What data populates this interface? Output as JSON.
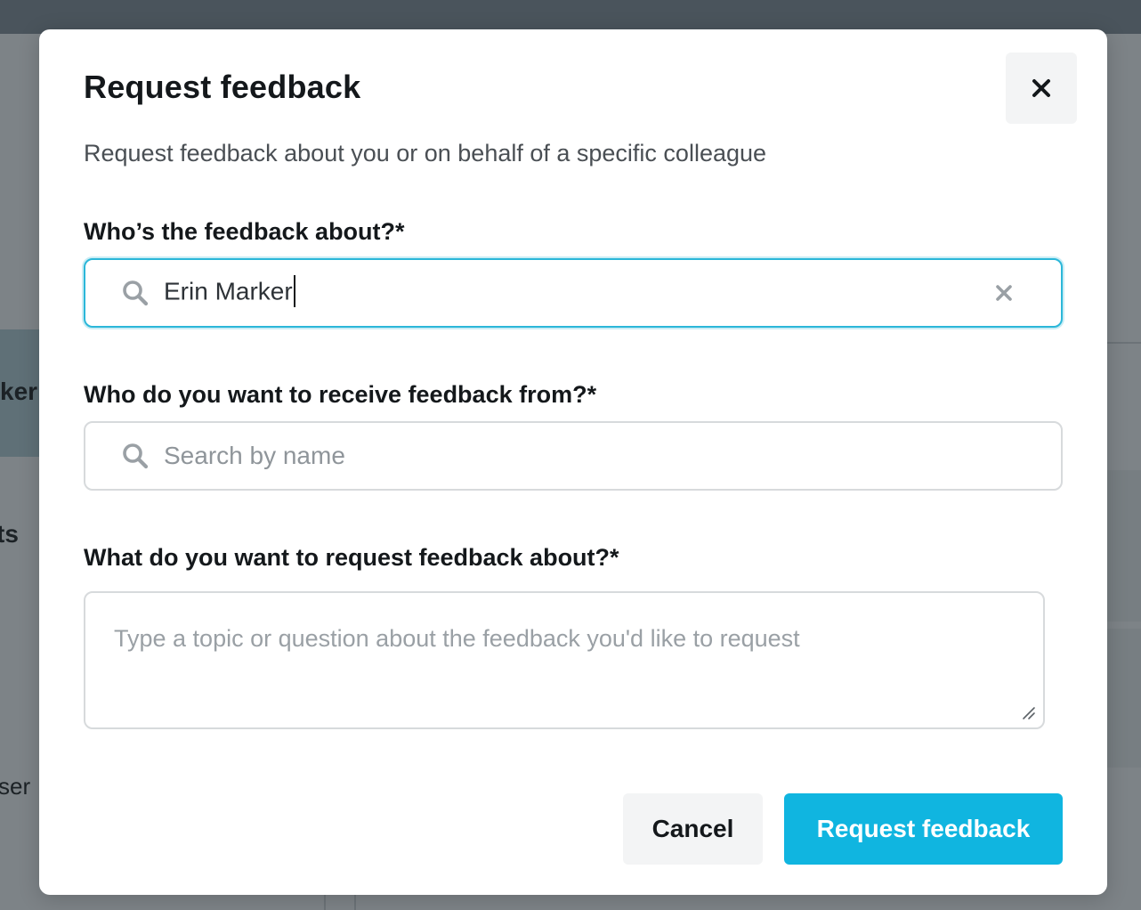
{
  "background": {
    "fragments": [
      "ker",
      "ts",
      "ser"
    ]
  },
  "modal": {
    "title": "Request feedback",
    "subtitle": "Request feedback about you or on behalf of a specific colleague",
    "close_icon": "close-icon",
    "fields": {
      "about": {
        "label": "Who’s the feedback about?*",
        "value": "Erin Marker",
        "icon": "search-icon",
        "clear_icon": "clear-icon",
        "focused": true
      },
      "from": {
        "label": "Who do you want to receive feedback from?*",
        "value": "",
        "placeholder": "Search by name",
        "icon": "search-icon"
      },
      "topic": {
        "label": "What do you want to request feedback about?*",
        "value": "",
        "placeholder": "Type a topic or question about the feedback you'd like to request"
      }
    },
    "buttons": {
      "cancel": "Cancel",
      "submit": "Request feedback"
    }
  },
  "colors": {
    "accent": "#10b5e0",
    "focus_border": "#2bb7d9",
    "overlay": "#7d8387"
  }
}
